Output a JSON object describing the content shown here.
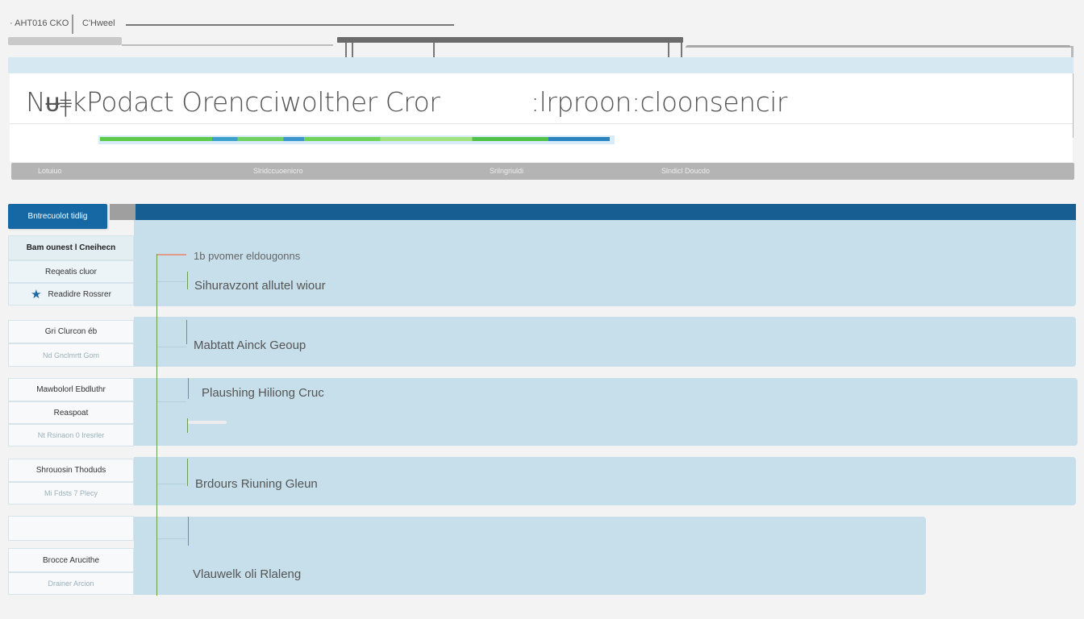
{
  "toolbar": {
    "crumb_1": "· AHT016 CKO",
    "crumb_2": "C'Hweel"
  },
  "header": {
    "title_part_1": "Nᵾǂ̶kPodact Orencciwolther Cror",
    "title_part_2": ":lrproon:cloonsencir",
    "progress": 1.0,
    "columns": [
      "Lotuiuo",
      "Slridccuoenicro",
      "Srilngriuldi",
      "Slndicl Doucdo"
    ]
  },
  "nav": {
    "active_tab": "Bntrecuolot tidlig",
    "items": [
      "Bam ounest l Cneihecn",
      "Reqeatis cluor",
      "Readidre Rossrer",
      "Gri Clurcon éb",
      "Nd Gnclmrtt Gom",
      "Mawbolorl Ebdluthr",
      "Reaspoat",
      "Nt Rsinaon 0 Iresrler",
      "Shrouosin Thoduds",
      "Mi Fdsts 7 Plecy",
      "",
      "Brocce Arucithe",
      "Drainer Arcion"
    ]
  },
  "content": {
    "items": [
      "1b pvomer eldougonns",
      "Sihuravzont allutel wiour",
      "Mabtatt Ainck Geoup",
      "Plaushing Hiliong Cruc",
      "Brdours Riuning Gleun",
      "Vlauwelk  oli Rlaleng"
    ]
  },
  "colors": {
    "accent": "#1668a5",
    "strip": "#175f92",
    "panel": "#c6dfea",
    "tree_line": "#6d9e4f"
  }
}
